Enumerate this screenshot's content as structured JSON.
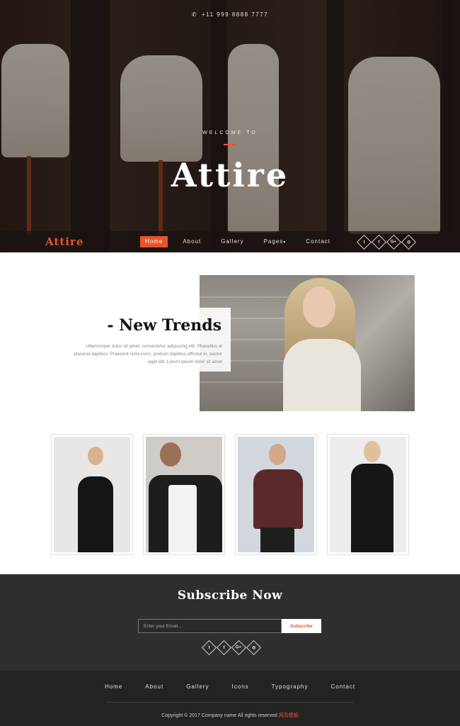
{
  "header": {
    "phone": "+11 999 8888 7777",
    "welcome": "WELCOME TO",
    "title": "Attire"
  },
  "navbar": {
    "logo": "Attire",
    "items": [
      "Home",
      "About",
      "Gallery",
      "Pages",
      "Contact"
    ],
    "active": "Home"
  },
  "social_icons": [
    "twitter-icon",
    "facebook-icon",
    "google-plus-icon",
    "dribbble-icon"
  ],
  "social_glyphs": [
    "t",
    "f",
    "G+",
    "◎"
  ],
  "trends": {
    "title": "- New Trends",
    "text": "Ullamcorper dolor sit amet, consectetur adipiscing elit. Phasellus at placerat dapibus. Praesent nulla nunc, pretium dapibus efficitur in, auctor eget elit. Lorem ipsum dolor sit amet"
  },
  "gallery": [
    {
      "name": "gallery-model-black-dress"
    },
    {
      "name": "gallery-model-leather-jacket"
    },
    {
      "name": "gallery-model-burgundy-blouse"
    },
    {
      "name": "gallery-model-black-turtleneck"
    }
  ],
  "subscribe": {
    "title": "Subscribe Now",
    "placeholder": "Enter your Email...",
    "button": "Subscribe"
  },
  "footer": {
    "links": [
      "Home",
      "About",
      "Gallery",
      "Icons",
      "Typography",
      "Contact"
    ],
    "copyright": "Copyright © 2017 Company name All rights reserved ",
    "copyright_highlight": "网页模板"
  },
  "colors": {
    "accent": "#e8542a",
    "dark_bg": "#2e2e2e",
    "footer_bg": "#232323"
  }
}
